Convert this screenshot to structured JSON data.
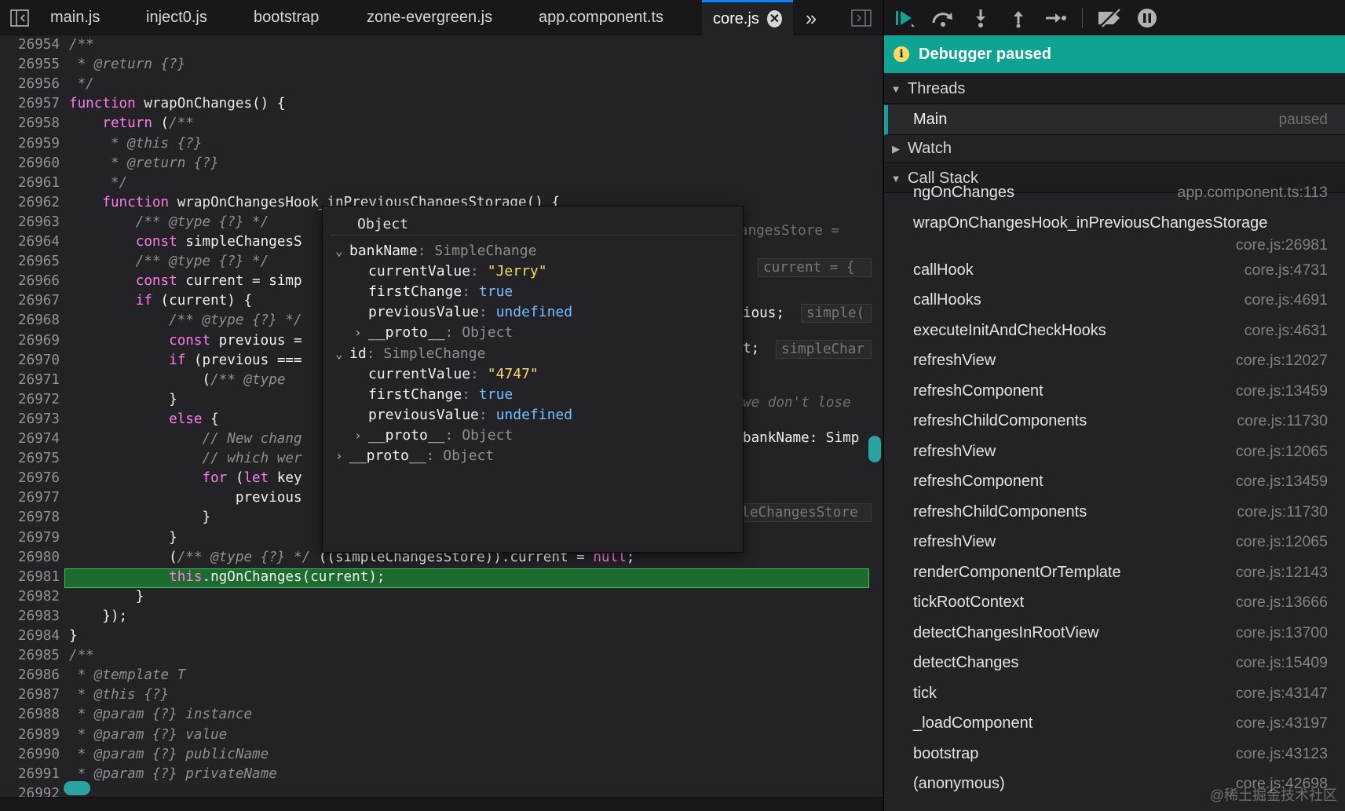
{
  "tabs": [
    {
      "label": "main.js"
    },
    {
      "label": "inject0.js"
    },
    {
      "label": "bootstrap"
    },
    {
      "label": "zone-evergreen.js"
    },
    {
      "label": "app.component.ts"
    },
    {
      "label": "core.js",
      "active": true
    }
  ],
  "tab_close_glyph": "✕",
  "tab_overflow_glyph": "»",
  "code_lines": [
    {
      "n": "26954",
      "html": "<span class='cm'>/**</span>"
    },
    {
      "n": "26955",
      "html": "<span class='cm'> * @return {?}</span>"
    },
    {
      "n": "26956",
      "html": "<span class='cm'> */</span>"
    },
    {
      "n": "26957",
      "html": "<span class='kw'>function</span> <span class='fn'>wrapOnChanges</span>() {"
    },
    {
      "n": "26958",
      "html": "    <span class='kw'>return</span> (<span class='cm'>/**</span>"
    },
    {
      "n": "26959",
      "html": "<span class='cm'>     * @this {?}</span>"
    },
    {
      "n": "26960",
      "html": "<span class='cm'>     * @return {?}</span>"
    },
    {
      "n": "26961",
      "html": "<span class='cm'>     */</span>"
    },
    {
      "n": "26962",
      "html": "    <span class='kw'>function</span> <span class='fn'>wrapOnChangesHook_inPreviousChangesStorage</span>() {"
    },
    {
      "n": "26963",
      "html": "        <span class='cm'>/** @type {?} */</span>"
    },
    {
      "n": "26964",
      "html": "        <span class='kw'>const</span> simpleChangesS"
    },
    {
      "n": "26965",
      "html": "        <span class='cm'>/** @type {?} */</span>"
    },
    {
      "n": "26966",
      "html": "        <span class='kw'>const</span> current = simp"
    },
    {
      "n": "26967",
      "html": "        <span class='kw'>if</span> (current) {"
    },
    {
      "n": "26968",
      "html": "            <span class='cm'>/** @type {?} */</span>"
    },
    {
      "n": "26969",
      "html": "            <span class='kw'>const</span> previous ="
    },
    {
      "n": "26970",
      "html": "            <span class='kw'>if</span> (previous ==="
    },
    {
      "n": "26971",
      "html": "                (<span class='cm'>/** @type</span>"
    },
    {
      "n": "26972",
      "html": "            }"
    },
    {
      "n": "26973",
      "html": "            <span class='kw'>else</span> {"
    },
    {
      "n": "26974",
      "html": "<span class='cm'>                // New chang</span>"
    },
    {
      "n": "26975",
      "html": "<span class='cm'>                // which wer</span>"
    },
    {
      "n": "26976",
      "html": "                <span class='kw'>for</span> (<span class='kw'>let</span> key"
    },
    {
      "n": "26977",
      "html": "                    previous"
    },
    {
      "n": "26978",
      "html": "                }"
    },
    {
      "n": "26979",
      "html": "            }"
    },
    {
      "n": "26980",
      "html": "            (<span class='cm'>/** @type {?} */</span> ((simpleChangesStore)).current = <span class='kw'>null</span>;"
    },
    {
      "n": "26981",
      "html": "            <span class='kw'>this</span>.ngOnChanges(current);",
      "highlight": true
    },
    {
      "n": "26982",
      "html": "        }"
    },
    {
      "n": "26983",
      "html": "    });"
    },
    {
      "n": "26984",
      "html": "}"
    },
    {
      "n": "26985",
      "html": "<span class='cm'>/**</span>"
    },
    {
      "n": "26986",
      "html": "<span class='cm'> * @template T</span>"
    },
    {
      "n": "26987",
      "html": "<span class='cm'> * @this {?}</span>"
    },
    {
      "n": "26988",
      "html": "<span class='cm'> * @param {?} instance</span>"
    },
    {
      "n": "26989",
      "html": "<span class='cm'> * @param {?} value</span>"
    },
    {
      "n": "26990",
      "html": "<span class='cm'> * @param {?} publicName</span>"
    },
    {
      "n": "26991",
      "html": "<span class='cm'> * @param {?} privateName</span>"
    },
    {
      "n": "26992",
      "html": ""
    }
  ],
  "inline_previews": [
    {
      "text": "angesStore = "
    },
    {
      "text": "current = {"
    },
    {
      "text": "ious;"
    },
    {
      "text": "simple("
    },
    {
      "text": "t;"
    },
    {
      "text": "simpleChar"
    },
    {
      "text": "we don't lose"
    },
    {
      "text": "bankName: Simp"
    },
    {
      "text": "simpleChangesStore"
    }
  ],
  "popup": {
    "title": "Object",
    "rows": [
      {
        "indent": 0,
        "arrow": "⌄",
        "key": "bankName",
        "type": "SimpleChange"
      },
      {
        "indent": 1,
        "key": "currentValue",
        "str": "\"Jerry\""
      },
      {
        "indent": 1,
        "key": "firstChange",
        "bool": "true"
      },
      {
        "indent": 1,
        "key": "previousValue",
        "bool": "undefined"
      },
      {
        "indent": 1,
        "arrow": "›",
        "key": "__proto__",
        "type": "Object"
      },
      {
        "indent": 0,
        "arrow": "⌄",
        "key": "id",
        "type": "SimpleChange"
      },
      {
        "indent": 1,
        "key": "currentValue",
        "str": "\"4747\""
      },
      {
        "indent": 1,
        "key": "firstChange",
        "bool": "true"
      },
      {
        "indent": 1,
        "key": "previousValue",
        "bool": "undefined"
      },
      {
        "indent": 1,
        "arrow": "›",
        "key": "__proto__",
        "type": "Object"
      },
      {
        "indent": 0,
        "arrow": "›",
        "key": "__proto__",
        "type": "Object"
      }
    ]
  },
  "debugger": {
    "paused_label": "Debugger paused",
    "threads_label": "Threads",
    "thread_main": "Main",
    "thread_state": "paused",
    "watch_label": "Watch",
    "callstack_label": "Call Stack",
    "frames": [
      {
        "name": "ngOnChanges",
        "loc": "app.component.ts:113"
      },
      {
        "name": "wrapOnChangesHook_inPreviousChangesStorage",
        "loc": "core.js:26981",
        "wrap": true
      },
      {
        "name": "callHook",
        "loc": "core.js:4731"
      },
      {
        "name": "callHooks",
        "loc": "core.js:4691"
      },
      {
        "name": "executeInitAndCheckHooks",
        "loc": "core.js:4631"
      },
      {
        "name": "refreshView",
        "loc": "core.js:12027"
      },
      {
        "name": "refreshComponent",
        "loc": "core.js:13459"
      },
      {
        "name": "refreshChildComponents",
        "loc": "core.js:11730"
      },
      {
        "name": "refreshView",
        "loc": "core.js:12065"
      },
      {
        "name": "refreshComponent",
        "loc": "core.js:13459"
      },
      {
        "name": "refreshChildComponents",
        "loc": "core.js:11730"
      },
      {
        "name": "refreshView",
        "loc": "core.js:12065"
      },
      {
        "name": "renderComponentOrTemplate",
        "loc": "core.js:12143"
      },
      {
        "name": "tickRootContext",
        "loc": "core.js:13666"
      },
      {
        "name": "detectChangesInRootView",
        "loc": "core.js:13700"
      },
      {
        "name": "detectChanges",
        "loc": "core.js:15409"
      },
      {
        "name": "tick",
        "loc": "core.js:43147"
      },
      {
        "name": "_loadComponent",
        "loc": "core.js:43197"
      },
      {
        "name": "bootstrap",
        "loc": "core.js:43123"
      },
      {
        "name": "(anonymous)",
        "loc": "core.js:42698"
      }
    ]
  },
  "watermark": "@稀土掘金技术社区",
  "colors": {
    "accent": "#0fa393",
    "active_tab_border": "#0a84ff",
    "current_line": "#1d6b2e"
  }
}
